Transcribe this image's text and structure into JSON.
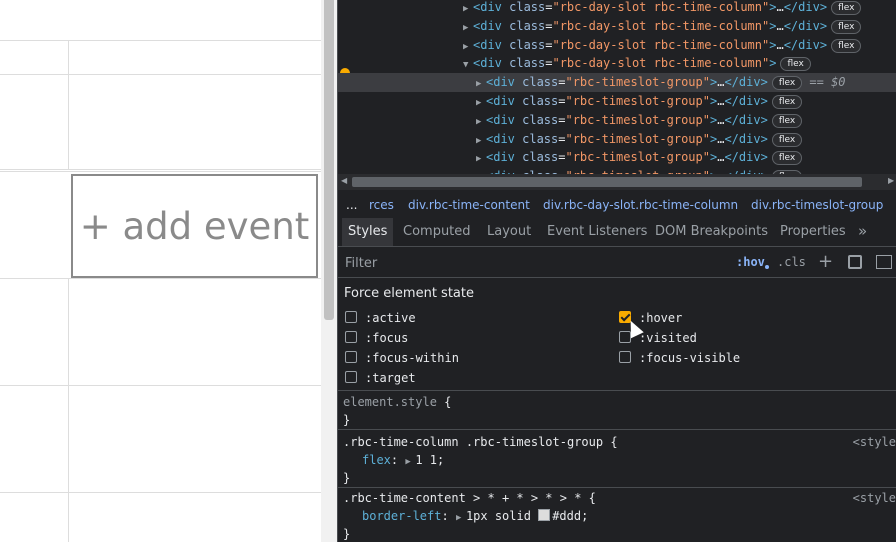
{
  "calendar": {
    "add_event_label": "+ add event"
  },
  "dom_tree": {
    "lines": [
      {
        "indent": 0,
        "open": false,
        "tag": "div",
        "class": "rbc-day-slot rbc-time-column",
        "badge": "flex"
      },
      {
        "indent": 0,
        "open": false,
        "tag": "div",
        "class": "rbc-day-slot rbc-time-column",
        "badge": "flex"
      },
      {
        "indent": 0,
        "open": false,
        "tag": "div",
        "class": "rbc-day-slot rbc-time-column",
        "badge": "flex"
      },
      {
        "indent": 0,
        "open": true,
        "tag": "div",
        "class": "rbc-day-slot rbc-time-column",
        "badge": "flex"
      },
      {
        "indent": 1,
        "open": false,
        "tag": "div",
        "class": "rbc-timeslot-group",
        "badge": "flex",
        "selected": true,
        "marker": "== $0"
      },
      {
        "indent": 1,
        "open": false,
        "tag": "div",
        "class": "rbc-timeslot-group",
        "badge": "flex"
      },
      {
        "indent": 1,
        "open": false,
        "tag": "div",
        "class": "rbc-timeslot-group",
        "badge": "flex"
      },
      {
        "indent": 1,
        "open": false,
        "tag": "div",
        "class": "rbc-timeslot-group",
        "badge": "flex"
      },
      {
        "indent": 1,
        "open": false,
        "tag": "div",
        "class": "rbc-timeslot-group",
        "badge": "flex"
      },
      {
        "indent": 1,
        "open": false,
        "tag": "div",
        "class": "rbc-timeslot-group",
        "badge": "flex"
      }
    ]
  },
  "breadcrumb": {
    "ellipsis": "...",
    "items": [
      "rces",
      "div.rbc-time-content",
      "div.rbc-day-slot.rbc-time-column",
      "div.rbc-timeslot-group"
    ]
  },
  "tabs": [
    "Styles",
    "Computed",
    "Layout",
    "Event Listeners",
    "DOM Breakpoints",
    "Properties"
  ],
  "tab_more": "»",
  "filter": {
    "placeholder": "Filter",
    "hov": ":hov",
    "cls": ".cls",
    "plus": "+"
  },
  "force_state": {
    "title": "Force element state",
    "states": [
      {
        "label": ":active",
        "checked": false
      },
      {
        "label": ":hover",
        "checked": true
      },
      {
        "label": ":focus",
        "checked": false
      },
      {
        "label": ":visited",
        "checked": false
      },
      {
        "label": ":focus-within",
        "checked": false
      },
      {
        "label": ":focus-visible",
        "checked": false
      },
      {
        "label": ":target",
        "checked": false
      }
    ]
  },
  "rules": {
    "element_style": {
      "selector": "element.style",
      "open": "{",
      "close": "}"
    },
    "rule1": {
      "selector": ".rbc-time-column .rbc-timeslot-group",
      "open": "{",
      "source": "<style",
      "prop": "flex",
      "value": "1 1;",
      "close": "}"
    },
    "rule2": {
      "selector": ".rbc-time-content > * + * > * > *",
      "open": "{",
      "source": "<style",
      "prop": "border-left",
      "value_pre": "1px solid",
      "value_color": "#ddd;",
      "close": "}"
    }
  },
  "colors": {
    "accent": "#8ab4f8",
    "checked": "#f9ab00",
    "tag": "#5db0d7",
    "attr_value": "#f29766"
  }
}
